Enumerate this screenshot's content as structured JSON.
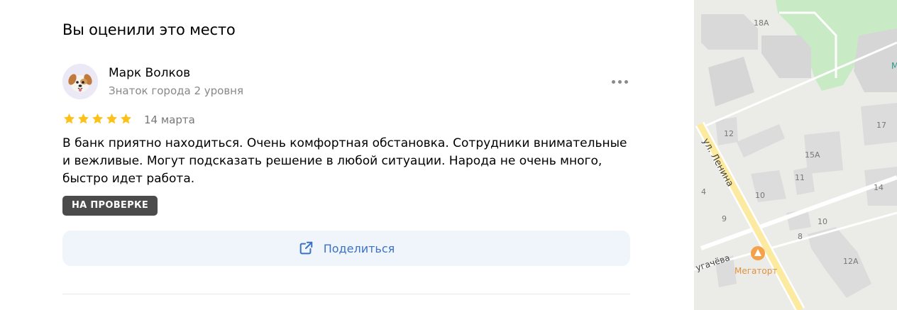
{
  "section": {
    "title": "Вы оценили это место"
  },
  "review": {
    "author": {
      "name": "Марк Волков",
      "level": "Знаток города 2 уровня",
      "avatar_icon": "dog-avatar-icon"
    },
    "rating": 5,
    "rating_max": 5,
    "date": "14 марта",
    "text": "В банк приятно находиться. Очень комфортная обстановка. Сотрудники внимательные и вежливые. Могут подсказать решение в любой ситуации. Народа не очень много, быстро идет работа.",
    "status_badge": "НА ПРОВЕРКЕ",
    "more_icon": "more-dots-icon"
  },
  "share": {
    "label": "Поделиться",
    "icon": "share-icon"
  },
  "map": {
    "street_label": "ул. Ленина",
    "street2_label": "угачёва",
    "poi": {
      "name": "Мегаторт",
      "icon": "cake-icon"
    },
    "house_numbers": [
      "18А",
      "12",
      "15А",
      "11",
      "10",
      "17",
      "14",
      "9",
      "10",
      "8",
      "12А",
      "4"
    ],
    "edge_letter": "М"
  },
  "colors": {
    "star": "#fcc21b",
    "badge_bg": "#4b4b4b",
    "share_text": "#3b72c4",
    "share_bg": "#f0f4fb",
    "poi": "#f5a14a"
  }
}
